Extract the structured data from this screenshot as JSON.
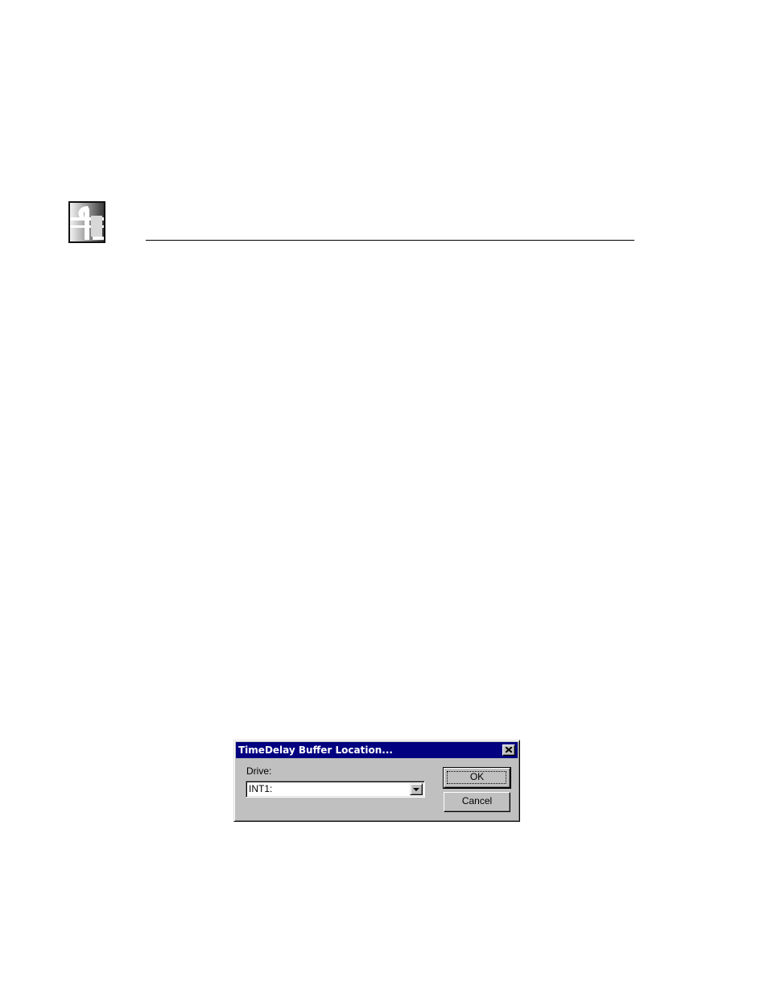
{
  "header": {
    "logo_icon": "company-logo-icon"
  },
  "dialog": {
    "title": "TimeDelay Buffer Location...",
    "close_icon": "close-icon",
    "drive_label": "Drive:",
    "drive_value": "INT1:",
    "dropdown_icon": "chevron-down-icon",
    "ok_label": "OK",
    "cancel_label": "Cancel",
    "colors": {
      "titlebar": "#000080",
      "face": "#c0c0c0"
    }
  }
}
